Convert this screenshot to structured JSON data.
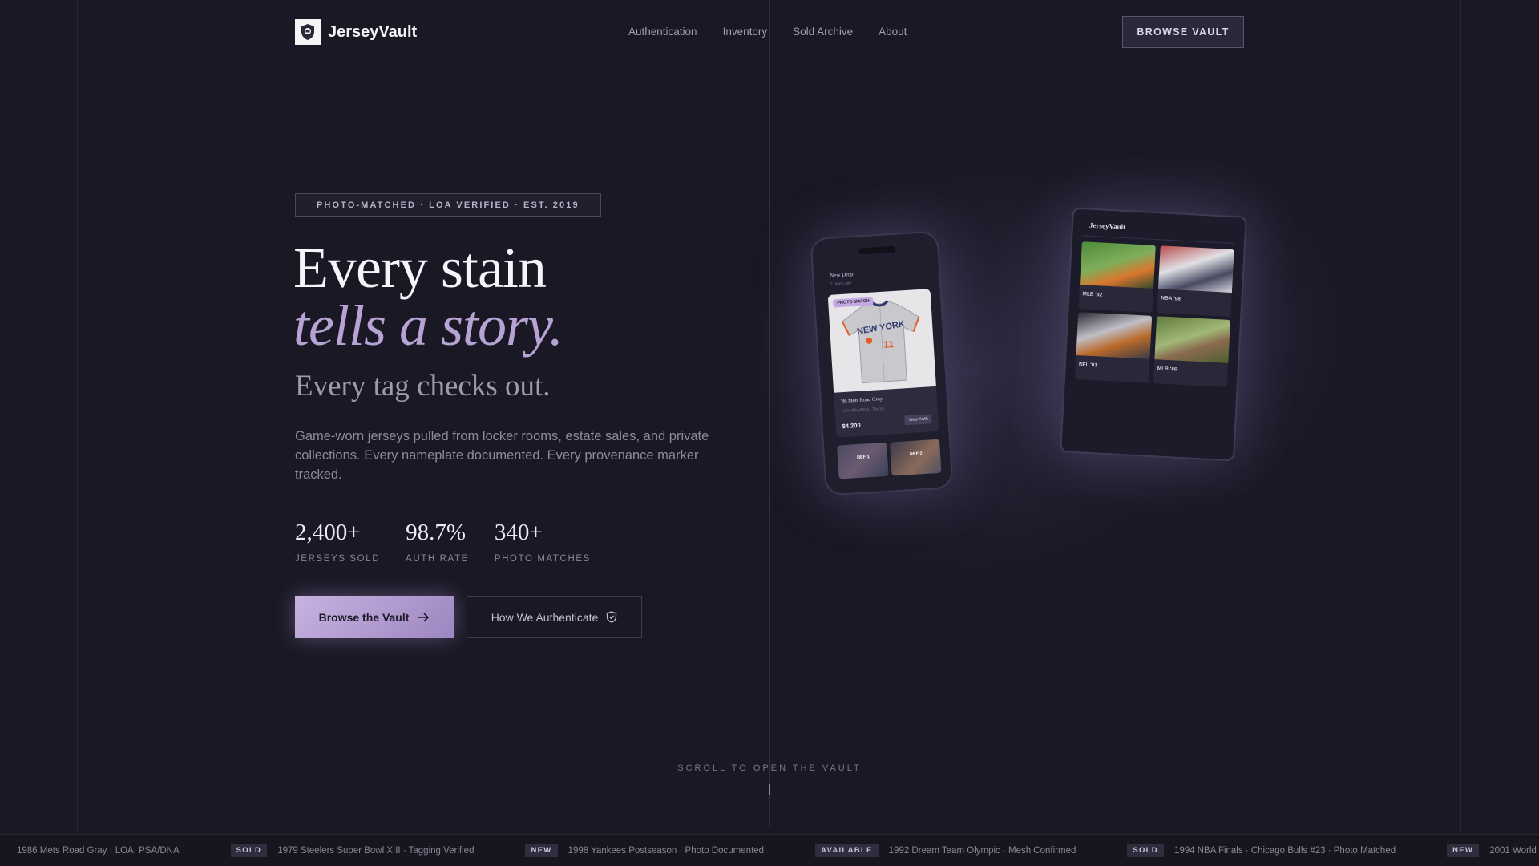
{
  "nav": {
    "brand": "JerseyVault",
    "links": [
      "Authentication",
      "Inventory",
      "Sold Archive",
      "About"
    ],
    "cta": "BROWSE VAULT"
  },
  "hero": {
    "badge": "PHOTO-MATCHED · LOA VERIFIED · EST. 2019",
    "title_line1": "Every stain",
    "title_line2": "tells a story.",
    "subtitle": "Every tag checks out.",
    "description": "Game-worn jerseys pulled from locker rooms, estate sales, and private collections. Every nameplate documented. Every provenance marker tracked.",
    "stats": [
      {
        "value": "2,400+",
        "label": "JERSEYS SOLD"
      },
      {
        "value": "98.7%",
        "label": "AUTH RATE"
      },
      {
        "value": "340+",
        "label": "PHOTO MATCHES"
      }
    ],
    "primary_cta": "Browse the Vault",
    "secondary_cta": "How We Authenticate"
  },
  "phone": {
    "header": "New Drop",
    "time": "2 hours ago",
    "tag": "PHOTO MATCH",
    "jersey_text": "NEW YORK",
    "jersey_number": "11",
    "item_name": "'86 Mets Road Gray",
    "item_meta": "LOA: PSA/DNA · Tax 24",
    "price": "$4,200",
    "button": "View Auth",
    "thumbs": [
      "REF 1",
      "REF 2"
    ]
  },
  "tablet": {
    "brand": "JerseyVault",
    "tiles": [
      "MLB '92",
      "NBA '98",
      "NFL '01",
      "MLB '86"
    ]
  },
  "scroll_hint": "SCROLL TO OPEN THE VAULT",
  "ticker": [
    {
      "tag": "",
      "text": "1986 Mets Road Gray · LOA: PSA/DNA"
    },
    {
      "tag": "SOLD",
      "text": "1979 Steelers Super Bowl XIII · Tagging Verified"
    },
    {
      "tag": "NEW",
      "text": "1998 Yankees Postseason · Photo Documented"
    },
    {
      "tag": "AVAILABLE",
      "text": "1992 Dream Team Olympic · Mesh Confirmed"
    },
    {
      "tag": "SOLD",
      "text": "1994 NBA Finals · Chicago Bulls #23 · Photo Matched"
    },
    {
      "tag": "NEW",
      "text": "2001 World"
    }
  ],
  "colors": {
    "background": "#191824",
    "accent": "#b7a2d4",
    "cta_gradient_start": "#c8b2e2",
    "cta_gradient_end": "#9d86c0"
  }
}
